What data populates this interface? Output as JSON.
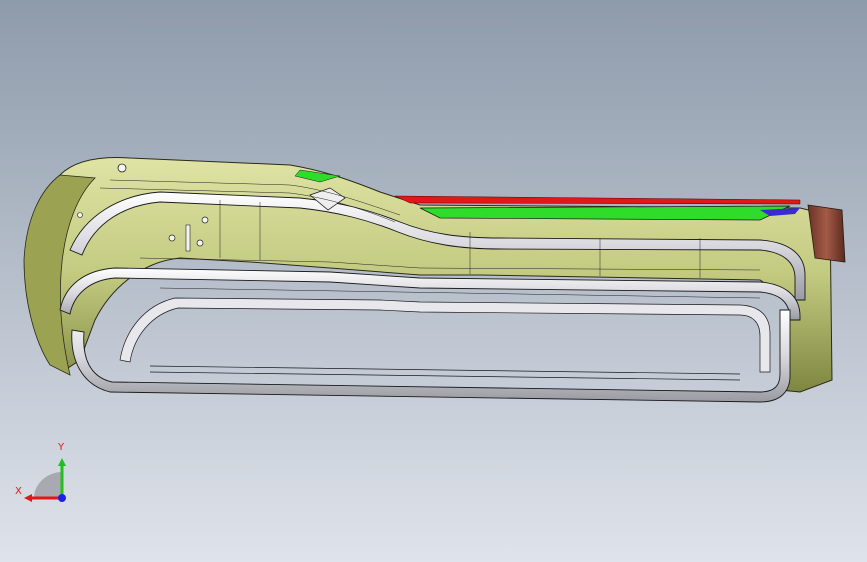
{
  "viewport": {
    "background_top": "#8e9bab",
    "background_bottom": "#dfe3eb"
  },
  "model": {
    "body_color": "#c9cf8a",
    "body_shadow": "#8c9448",
    "rail_color": "#f2f2f4",
    "edge_color": "#1a1a1a",
    "accent_green": "#2fdc2a",
    "accent_red": "#e01818",
    "accent_blue": "#3a2bd0",
    "end_cap_color": "#8a4a3a"
  },
  "triad": {
    "x_label": "X",
    "y_label": "Y",
    "x_color": "#e01818",
    "y_color": "#20c020",
    "z_color": "#2020e0",
    "label_color": "#e01818"
  }
}
